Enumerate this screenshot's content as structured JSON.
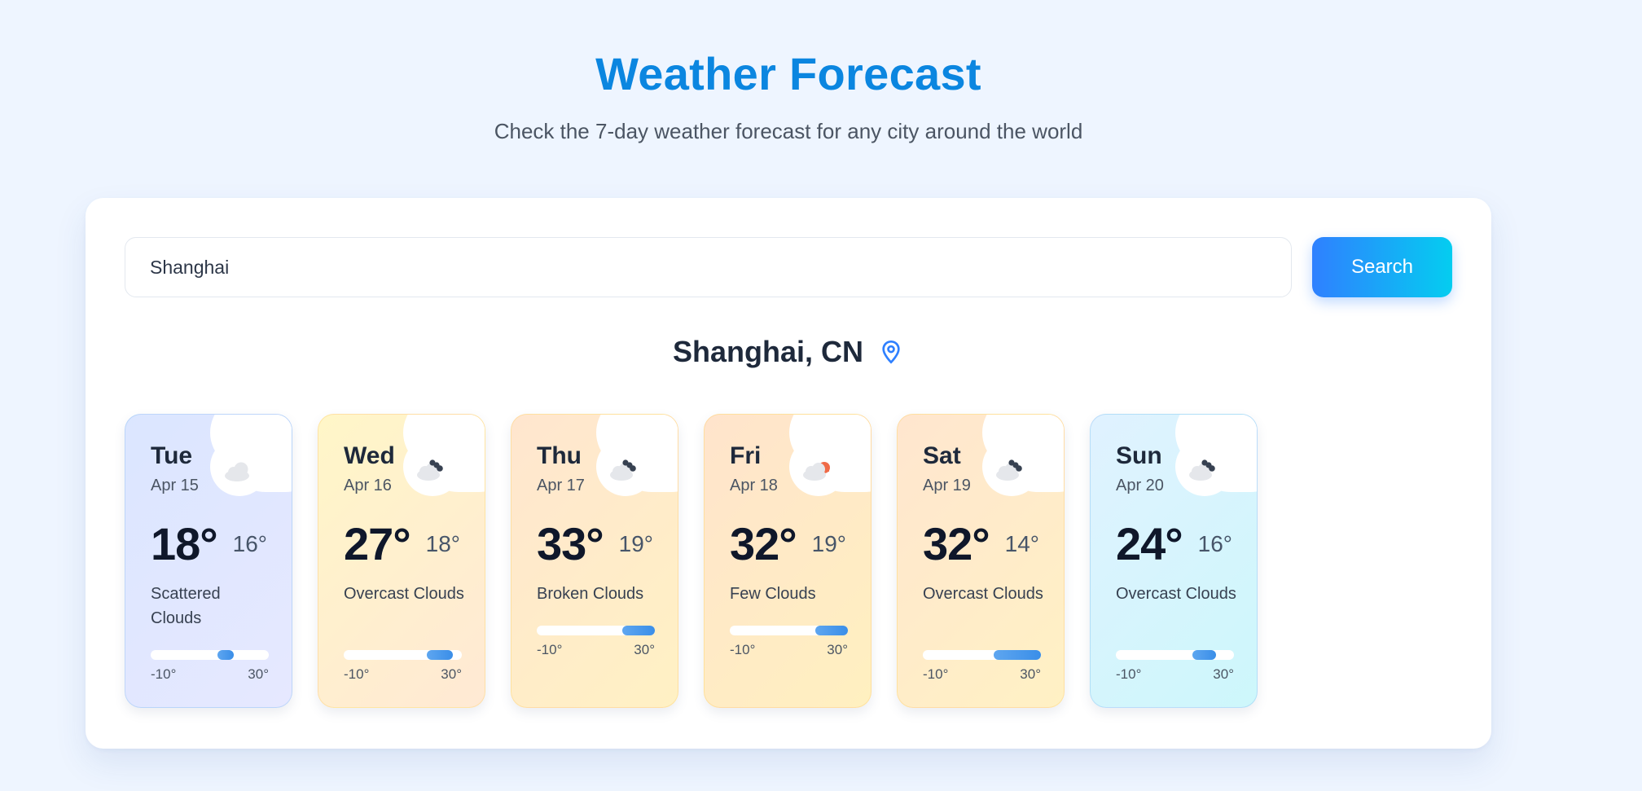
{
  "header": {
    "title": "Weather Forecast",
    "subtitle": "Check the 7-day weather forecast for any city around the world"
  },
  "search": {
    "value": "Shanghai",
    "button_label": "Search"
  },
  "location": {
    "city": "Shanghai, CN",
    "icon": "map-pin-icon"
  },
  "scale": {
    "min": "-10°",
    "max": "30°",
    "min_value": -10,
    "max_value": 30
  },
  "forecast": [
    {
      "day": "Tue",
      "date": "Apr 15",
      "high": "18°",
      "low": "16°",
      "high_value": 18,
      "low_value": 16,
      "description": "Scattered Clouds",
      "icon": "cloud-icon",
      "bg": [
        "#dbe6ff",
        "#e6e8ff"
      ]
    },
    {
      "day": "Wed",
      "date": "Apr 16",
      "high": "27°",
      "low": "18°",
      "high_value": 27,
      "low_value": 18,
      "description": "Overcast Clouds",
      "icon": "overcast-cloud-icon",
      "bg": [
        "#fff6c8",
        "#ffe9d4"
      ]
    },
    {
      "day": "Thu",
      "date": "Apr 17",
      "high": "33°",
      "low": "19°",
      "high_value": 33,
      "low_value": 19,
      "description": "Broken Clouds",
      "icon": "broken-clouds-icon",
      "bg": [
        "#ffe6cf",
        "#fff1c4"
      ]
    },
    {
      "day": "Fri",
      "date": "Apr 18",
      "high": "32°",
      "low": "19°",
      "high_value": 32,
      "low_value": 19,
      "description": "Few Clouds",
      "icon": "sun-behind-cloud-icon",
      "bg": [
        "#ffe4cc",
        "#fff0c0"
      ]
    },
    {
      "day": "Sat",
      "date": "Apr 19",
      "high": "32°",
      "low": "14°",
      "high_value": 32,
      "low_value": 14,
      "description": "Overcast Clouds",
      "icon": "overcast-cloud-icon",
      "bg": [
        "#ffe6cf",
        "#fff1c4"
      ]
    },
    {
      "day": "Sun",
      "date": "Apr 20",
      "high": "24°",
      "low": "16°",
      "high_value": 24,
      "low_value": 16,
      "description": "Overcast Clouds",
      "icon": "overcast-cloud-icon",
      "bg": [
        "#e0f2ff",
        "#cdf7fb"
      ]
    }
  ],
  "colors": {
    "title": "#0b86e0",
    "button_gradient": [
      "#2f80ff",
      "#04cdf0"
    ],
    "bar_fill": "#4a96ec",
    "sun": "#ef6a47"
  }
}
